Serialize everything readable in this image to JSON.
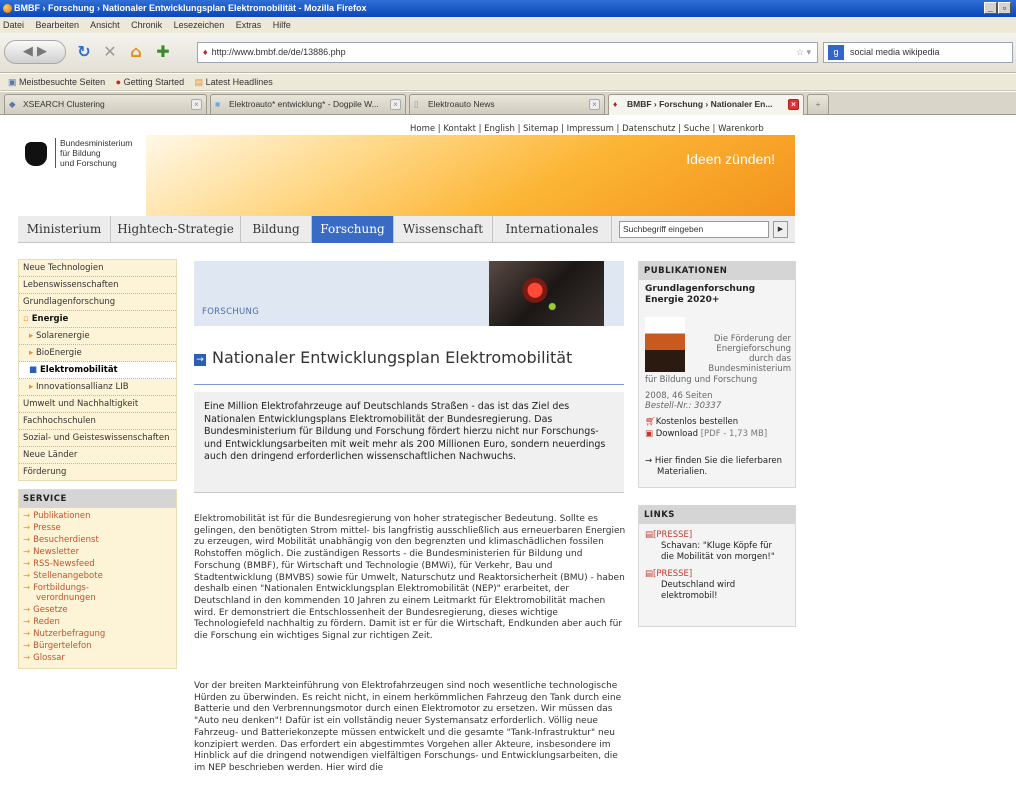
{
  "window": {
    "title": "BMBF › Forschung › Nationaler Entwicklungsplan Elektromobilität - Mozilla Firefox"
  },
  "menu": [
    "Datei",
    "Bearbeiten",
    "Ansicht",
    "Chronik",
    "Lesezeichen",
    "Extras",
    "Hilfe"
  ],
  "toolbar": {
    "url": "http://www.bmbf.de/de/13886.php",
    "search_value": "social media wikipedia"
  },
  "bookmarks": [
    "Meistbesuchte Seiten",
    "Getting Started",
    "Latest Headlines"
  ],
  "tabs": [
    "XSEARCH Clustering",
    "Elektroauto* entwicklung* - Dogpile W...",
    "Elektroauto News",
    "BMBF › Forschung › Nationaler En..."
  ],
  "page": {
    "toplinks": "Home | Kontakt | English | Sitemap | Impressum | Datenschutz | Suche | Warenkorb",
    "logo": "Bundesministerium\nfür Bildung\nund Forschung",
    "slogan": "Ideen zünden!",
    "mainnav": [
      "Ministerium",
      "Hightech-Strategie",
      "Bildung",
      "Forschung",
      "Wissenschaft",
      "Internationales"
    ],
    "search_placeholder": "Suchbegriff eingeben",
    "leftnav": [
      "Neue Technologien",
      "Lebenswissenschaften",
      "Grundlagenforschung",
      "Energie",
      "Solarenergie",
      "BioEnergie",
      "Elektromobilität",
      "Innovationsallianz LIB",
      "Umwelt und Nachhaltigkeit",
      "Fachhochschulen",
      "Sozial- und Geisteswissenschaften",
      "Neue Länder",
      "Förderung"
    ],
    "service_title": "SERVICE",
    "service": [
      "Publikationen",
      "Presse",
      "Besucherdienst",
      "Newsletter",
      "RSS-Newsfeed",
      "Stellenangebote",
      "Fortbildungs- verordnungen",
      "Gesetze",
      "Reden",
      "Nutzerbefragung",
      "Bürgertelefon",
      "Glossar"
    ],
    "section_label": "FORSCHUNG",
    "heading": "Nationaler Entwicklungsplan Elektromobilität",
    "lead": "Eine Million Elektrofahrzeuge auf Deutschlands Straßen - das ist das Ziel des Nationalen Entwicklungsplans Elektromobilität der Bundesregierung. Das Bundesministerium für Bildung und Forschung fördert hierzu nicht nur Forschungs- und Entwicklungsarbeiten mit weit mehr als 200 Millionen Euro, sondern neuerdings auch den dringend erforderlichen wissenschaftlichen Nachwuchs.",
    "para1": "Elektromobilität ist für die Bundesregierung von hoher strategischer Bedeutung. Sollte es gelingen, den benötigten Strom mittel- bis langfristig ausschließlich aus erneuerbaren Energien zu erzeugen, wird Mobilität unabhängig von den begrenzten und klimaschädlichen fossilen Rohstoffen möglich. Die zuständigen Ressorts - die Bundesministerien für Bildung und Forschung (BMBF), für Wirtschaft und Technologie (BMWi), für Verkehr, Bau und Stadtentwicklung (BMVBS) sowie für Umwelt, Naturschutz und Reaktorsicherheit (BMU) - haben deshalb einen \"Nationalen Entwicklungsplan Elektromobilität (NEP)\" erarbeitet, der Deutschland in den kommenden 10 Jahren zu einem Leitmarkt für Elektromobilität machen wird. Er demonstriert die Entschlossenheit der Bundesregierung, dieses wichtige Technologiefeld nachhaltig zu fördern. Damit ist er für die Wirtschaft, Endkunden aber auch für die Forschung ein wichtiges Signal zur richtigen Zeit.",
    "para2": "Vor der breiten Markteinführung von Elektrofahrzeugen sind noch wesentliche technologische Hürden zu überwinden. Es reicht nicht, in einem herkömmlichen Fahrzeug den Tank durch eine Batterie und den Verbrennungsmotor durch einen Elektromotor zu ersetzen. Wir müssen das \"Auto neu denken\"! Dafür ist ein vollständig neuer Systemansatz erforderlich. Völlig neue Fahrzeug- und Batteriekonzepte müssen entwickelt und die gesamte \"Tank-Infrastruktur\" neu konzipiert werden. Das erfordert ein abgestimmtes Vorgehen aller Akteure, insbesondere im Hinblick auf die dringend notwendigen vielfältigen Forschungs- und Entwicklungsarbeiten, die im NEP beschrieben werden. Hier wird die",
    "pub": {
      "title": "PUBLIKATIONEN",
      "name": "Grundlagenforschung Energie 2020+",
      "desc": "Die Förderung der Energieforschung durch das Bundesministerium",
      "desc2": "für Bildung und Forschung",
      "meta": "2008, 46 Seiten",
      "order": "Bestell-Nr.: 30337",
      "order_link": "Kostenlos bestellen",
      "download": "Download",
      "download_meta": "[PDF - 1,73 MB]",
      "more": "Hier finden Sie die lieferbaren Materialien."
    },
    "links": {
      "title": "LINKS",
      "items": [
        {
          "tag": "[PRESSE]",
          "text": "Schavan: \"Kluge Köpfe für die Mobilität von morgen!\""
        },
        {
          "tag": "[PRESSE]",
          "text": "Deutschland wird elektromobil!"
        }
      ]
    }
  }
}
